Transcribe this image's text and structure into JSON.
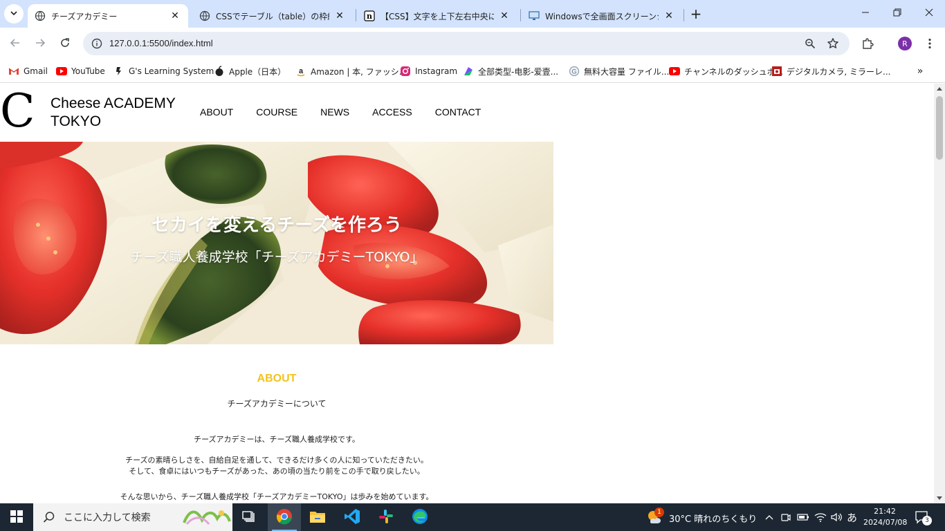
{
  "browser": {
    "tabs": [
      {
        "title": "チーズアカデミー",
        "active": true
      },
      {
        "title": "CSSでテーブル（table）の枠線（ボ",
        "active": false
      },
      {
        "title": "【CSS】文字を上下左右中央に配置",
        "active": false
      },
      {
        "title": "Windowsで全画面スクリーンショット",
        "active": false
      }
    ],
    "url": "127.0.0.1:5500/index.html",
    "profile_initial": "R",
    "bookmarks": [
      {
        "label": "Gmail",
        "icon": "gmail-icon"
      },
      {
        "label": "YouTube",
        "icon": "youtube-icon"
      },
      {
        "label": "G's Learning System",
        "icon": "gs-icon"
      },
      {
        "label": "Apple（日本）",
        "icon": "apple-icon"
      },
      {
        "label": "Amazon | 本, ファッシ...",
        "icon": "amazon-icon"
      },
      {
        "label": "Instagram",
        "icon": "instagram-icon"
      },
      {
        "label": "全部类型-电影-爱壹...",
        "icon": "iqiyi-icon"
      },
      {
        "label": "無料大容量 ファイル...",
        "icon": "gigafile-icon"
      },
      {
        "label": "チャンネルのダッシュボ...",
        "icon": "youtube-studio-icon"
      },
      {
        "label": "デジタルカメラ, ミラーレ...",
        "icon": "camera-store-icon"
      }
    ]
  },
  "site": {
    "logo_mark": "C",
    "logo_line1": "Cheese ACADEMY",
    "logo_line2": "TOKYO",
    "nav": [
      "ABOUT",
      "COURSE",
      "NEWS",
      "ACCESS",
      "CONTACT"
    ],
    "hero_title": "セカイを変えるチーズを作ろう",
    "hero_subtitle": "チーズ職人養成学校「チーズアカデミーTOKYO」",
    "about": {
      "heading": "ABOUT",
      "subheading": "チーズアカデミーについて",
      "p1": "チーズアカデミーは、チーズ職人養成学校です。",
      "p2a": "チーズの素晴らしさを、自給自足を通して、できるだけ多くの人に知っていただきたい。",
      "p2b": "そして、食卓にはいつもチーズがあった、あの頃の当たり前をこの手で取り戻したい。",
      "p3": "そんな思いから、チーズ職人養成学校「チーズアカデミーTOKYO」は歩みを始めています。",
      "accent_color": "#f3c31c"
    }
  },
  "taskbar": {
    "search_placeholder": "ここに入力して検索",
    "weather": "30°C  晴れのちくもり",
    "weather_badge": "1",
    "ime": "あ",
    "time": "21:42",
    "date": "2024/07/08",
    "notification_count": "3"
  }
}
